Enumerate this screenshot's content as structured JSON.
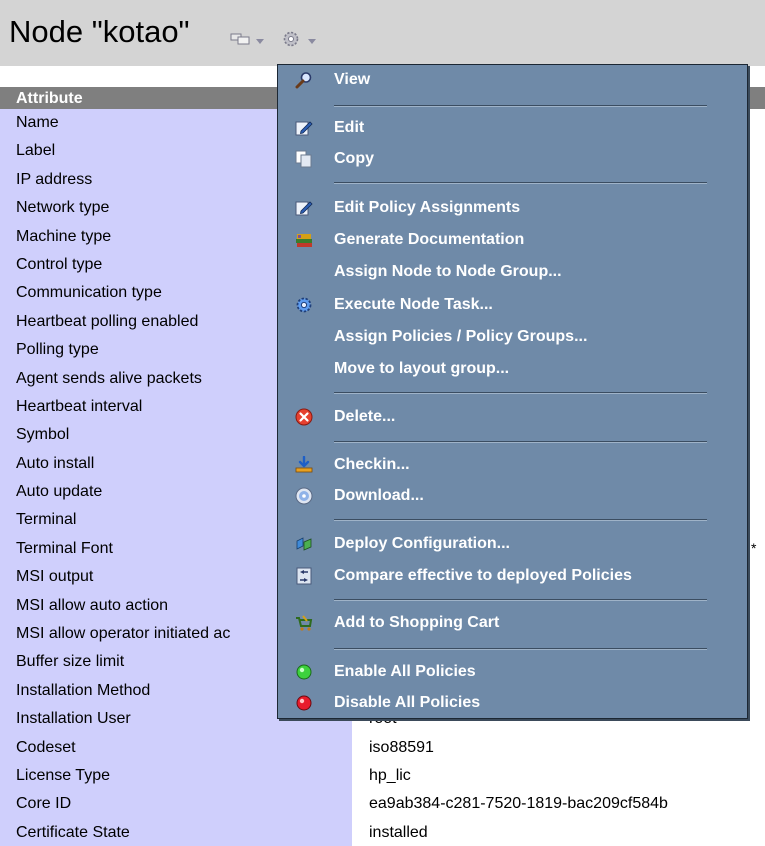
{
  "header": {
    "title": "Node \"kotao\"",
    "icons": [
      "node-view-icon",
      "dropdown-arrow-icon",
      "gear-icon",
      "dropdown-arrow-icon"
    ]
  },
  "table": {
    "header": "Attribute",
    "rows": [
      {
        "attr": "Name",
        "value": ""
      },
      {
        "attr": "Label",
        "value": ""
      },
      {
        "attr": "IP address",
        "value": ""
      },
      {
        "attr": "Network type",
        "value": ""
      },
      {
        "attr": "Machine type",
        "value": ""
      },
      {
        "attr": "Control type",
        "value": ""
      },
      {
        "attr": "Communication type",
        "value": ""
      },
      {
        "attr": "Heartbeat polling enabled",
        "value": ""
      },
      {
        "attr": "Polling type",
        "value": ""
      },
      {
        "attr": "Agent sends alive packets",
        "value": ""
      },
      {
        "attr": "Heartbeat interval",
        "value": ""
      },
      {
        "attr": "Symbol",
        "value": ""
      },
      {
        "attr": "Auto install",
        "value": ""
      },
      {
        "attr": "Auto update",
        "value": ""
      },
      {
        "attr": "Terminal",
        "value": ""
      },
      {
        "attr": "Terminal Font",
        "value": ""
      },
      {
        "attr": "MSI output",
        "value": ""
      },
      {
        "attr": "MSI allow auto action",
        "value": ""
      },
      {
        "attr": "MSI allow operator initiated ac",
        "value": ""
      },
      {
        "attr": "Buffer size limit",
        "value": ""
      },
      {
        "attr": "Installation Method",
        "value": ""
      },
      {
        "attr": "Installation User",
        "value": "root"
      },
      {
        "attr": "Codeset",
        "value": "iso88591"
      },
      {
        "attr": "License Type",
        "value": "hp_lic"
      },
      {
        "attr": "Core ID",
        "value": "ea9ab384-c281-7520-1819-bac209cf584b"
      },
      {
        "attr": "Certificate State",
        "value": "installed"
      }
    ],
    "stray_fragment": "*"
  },
  "menu": {
    "items": [
      {
        "label": "View",
        "icon": "magnifier-icon"
      },
      {
        "label": "Edit",
        "icon": "edit-pencil-icon"
      },
      {
        "label": "Copy",
        "icon": "copy-icon"
      },
      {
        "label": "Edit Policy Assignments",
        "icon": "edit-pencil-icon"
      },
      {
        "label": "Generate Documentation",
        "icon": "books-icon"
      },
      {
        "label": "Assign Node to Node Group...",
        "icon": ""
      },
      {
        "label": "Execute Node Task...",
        "icon": "gear-icon"
      },
      {
        "label": "Assign Policies / Policy Groups...",
        "icon": ""
      },
      {
        "label": "Move to layout group...",
        "icon": ""
      },
      {
        "label": "Delete...",
        "icon": "delete-icon"
      },
      {
        "label": "Checkin...",
        "icon": "checkin-icon"
      },
      {
        "label": "Download...",
        "icon": "download-disc-icon"
      },
      {
        "label": "Deploy Configuration...",
        "icon": "deploy-icon"
      },
      {
        "label": "Compare effective to deployed Policies",
        "icon": "compare-icon"
      },
      {
        "label": "Add to Shopping Cart",
        "icon": "shopping-cart-icon"
      },
      {
        "label": "Enable All Policies",
        "icon": "green-light-icon"
      },
      {
        "label": "Disable All Policies",
        "icon": "red-light-icon"
      }
    ]
  },
  "colors": {
    "menu_bg": "#6f8aa8",
    "attr_col_bg": "#cfcffc",
    "table_header_bg": "#7f7f7f",
    "page_header_bg": "#d4d4d4"
  }
}
